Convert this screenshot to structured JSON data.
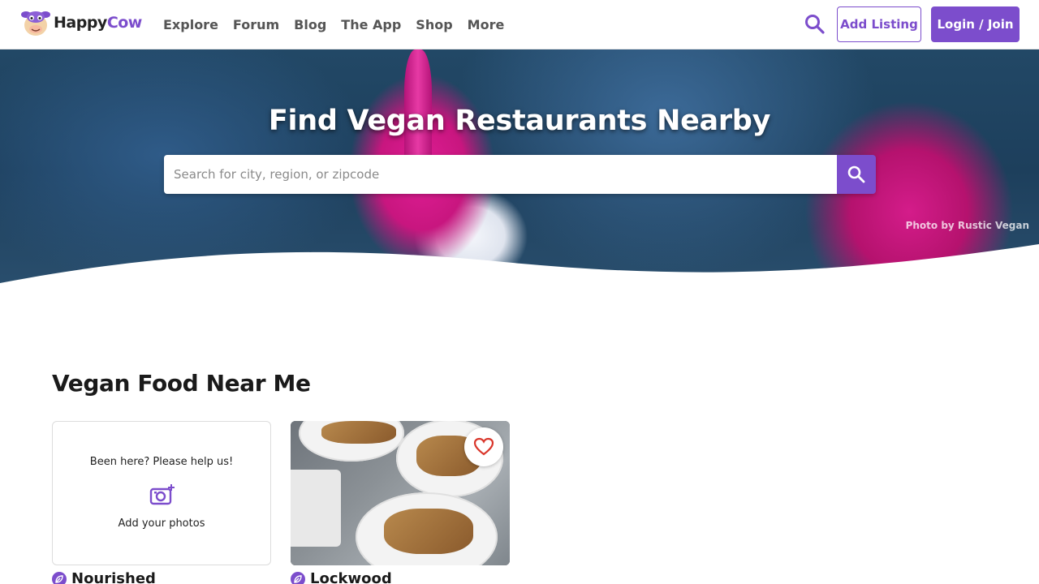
{
  "brand": {
    "happy": "Happy",
    "cow": "Cow"
  },
  "nav": {
    "items": [
      "Explore",
      "Forum",
      "Blog",
      "The App",
      "Shop",
      "More"
    ]
  },
  "header": {
    "add_listing": "Add Listing",
    "login_join": "Login / Join"
  },
  "hero": {
    "title": "Find Vegan Restaurants Nearby",
    "search_placeholder": "Search for city, region, or zipcode",
    "photo_credit": "Photo by Rustic Vegan"
  },
  "section": {
    "title": "Vegan Food Near Me",
    "cards": [
      {
        "name": "Nourished",
        "help_text": "Been here? Please help us!",
        "add_photos": "Add your photos"
      },
      {
        "name": "Lockwood"
      }
    ]
  },
  "colors": {
    "brand_purple": "#7c4dcc",
    "heart_red": "#d9362b"
  }
}
